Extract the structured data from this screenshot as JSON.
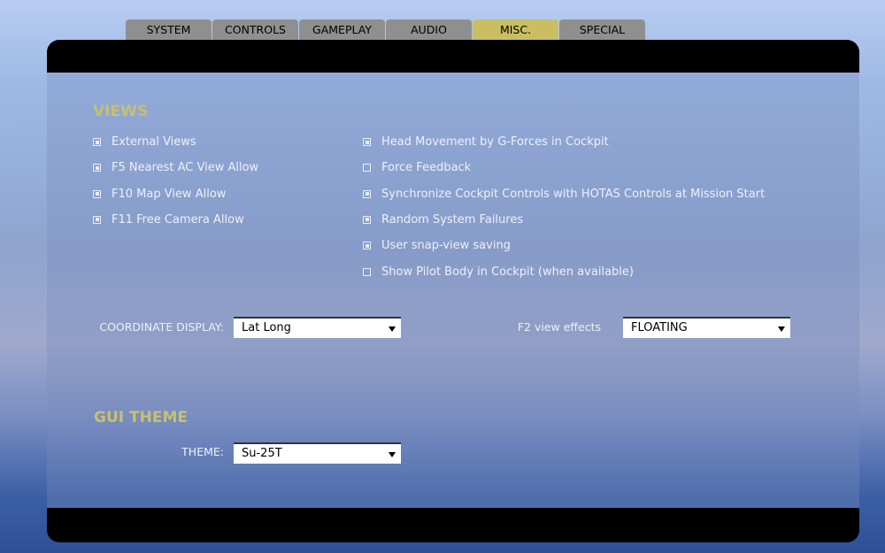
{
  "tabs": [
    "SYSTEM",
    "CONTROLS",
    "GAMEPLAY",
    "AUDIO",
    "MISC.",
    "SPECIAL"
  ],
  "active_tab": "MISC.",
  "views": {
    "title": "VIEWS",
    "left": [
      {
        "label": "External Views",
        "checked": true
      },
      {
        "label": "F5 Nearest AC View Allow",
        "checked": true
      },
      {
        "label": "F10 Map View Allow",
        "checked": true
      },
      {
        "label": "F11 Free Camera Allow",
        "checked": true
      }
    ],
    "right": [
      {
        "label": "Head Movement by G-Forces in Cockpit",
        "checked": true
      },
      {
        "label": "Force Feedback",
        "checked": false
      },
      {
        "label": "Synchronize Cockpit Controls with HOTAS Controls at Mission Start",
        "checked": true
      },
      {
        "label": "Random System Failures",
        "checked": true
      },
      {
        "label": "User snap-view saving",
        "checked": true
      },
      {
        "label": "Show Pilot Body in Cockpit (when available)",
        "checked": false
      }
    ],
    "coord_label": "COORDINATE DISPLAY:",
    "coord_value": "Lat Long",
    "f2_label": "F2 view effects",
    "f2_value": "FLOATING"
  },
  "gui": {
    "title": "GUI THEME",
    "theme_label": "THEME:",
    "theme_value": "Su-25T"
  },
  "colors": {
    "accent": "#c9bf62",
    "header": "#c8c070"
  }
}
